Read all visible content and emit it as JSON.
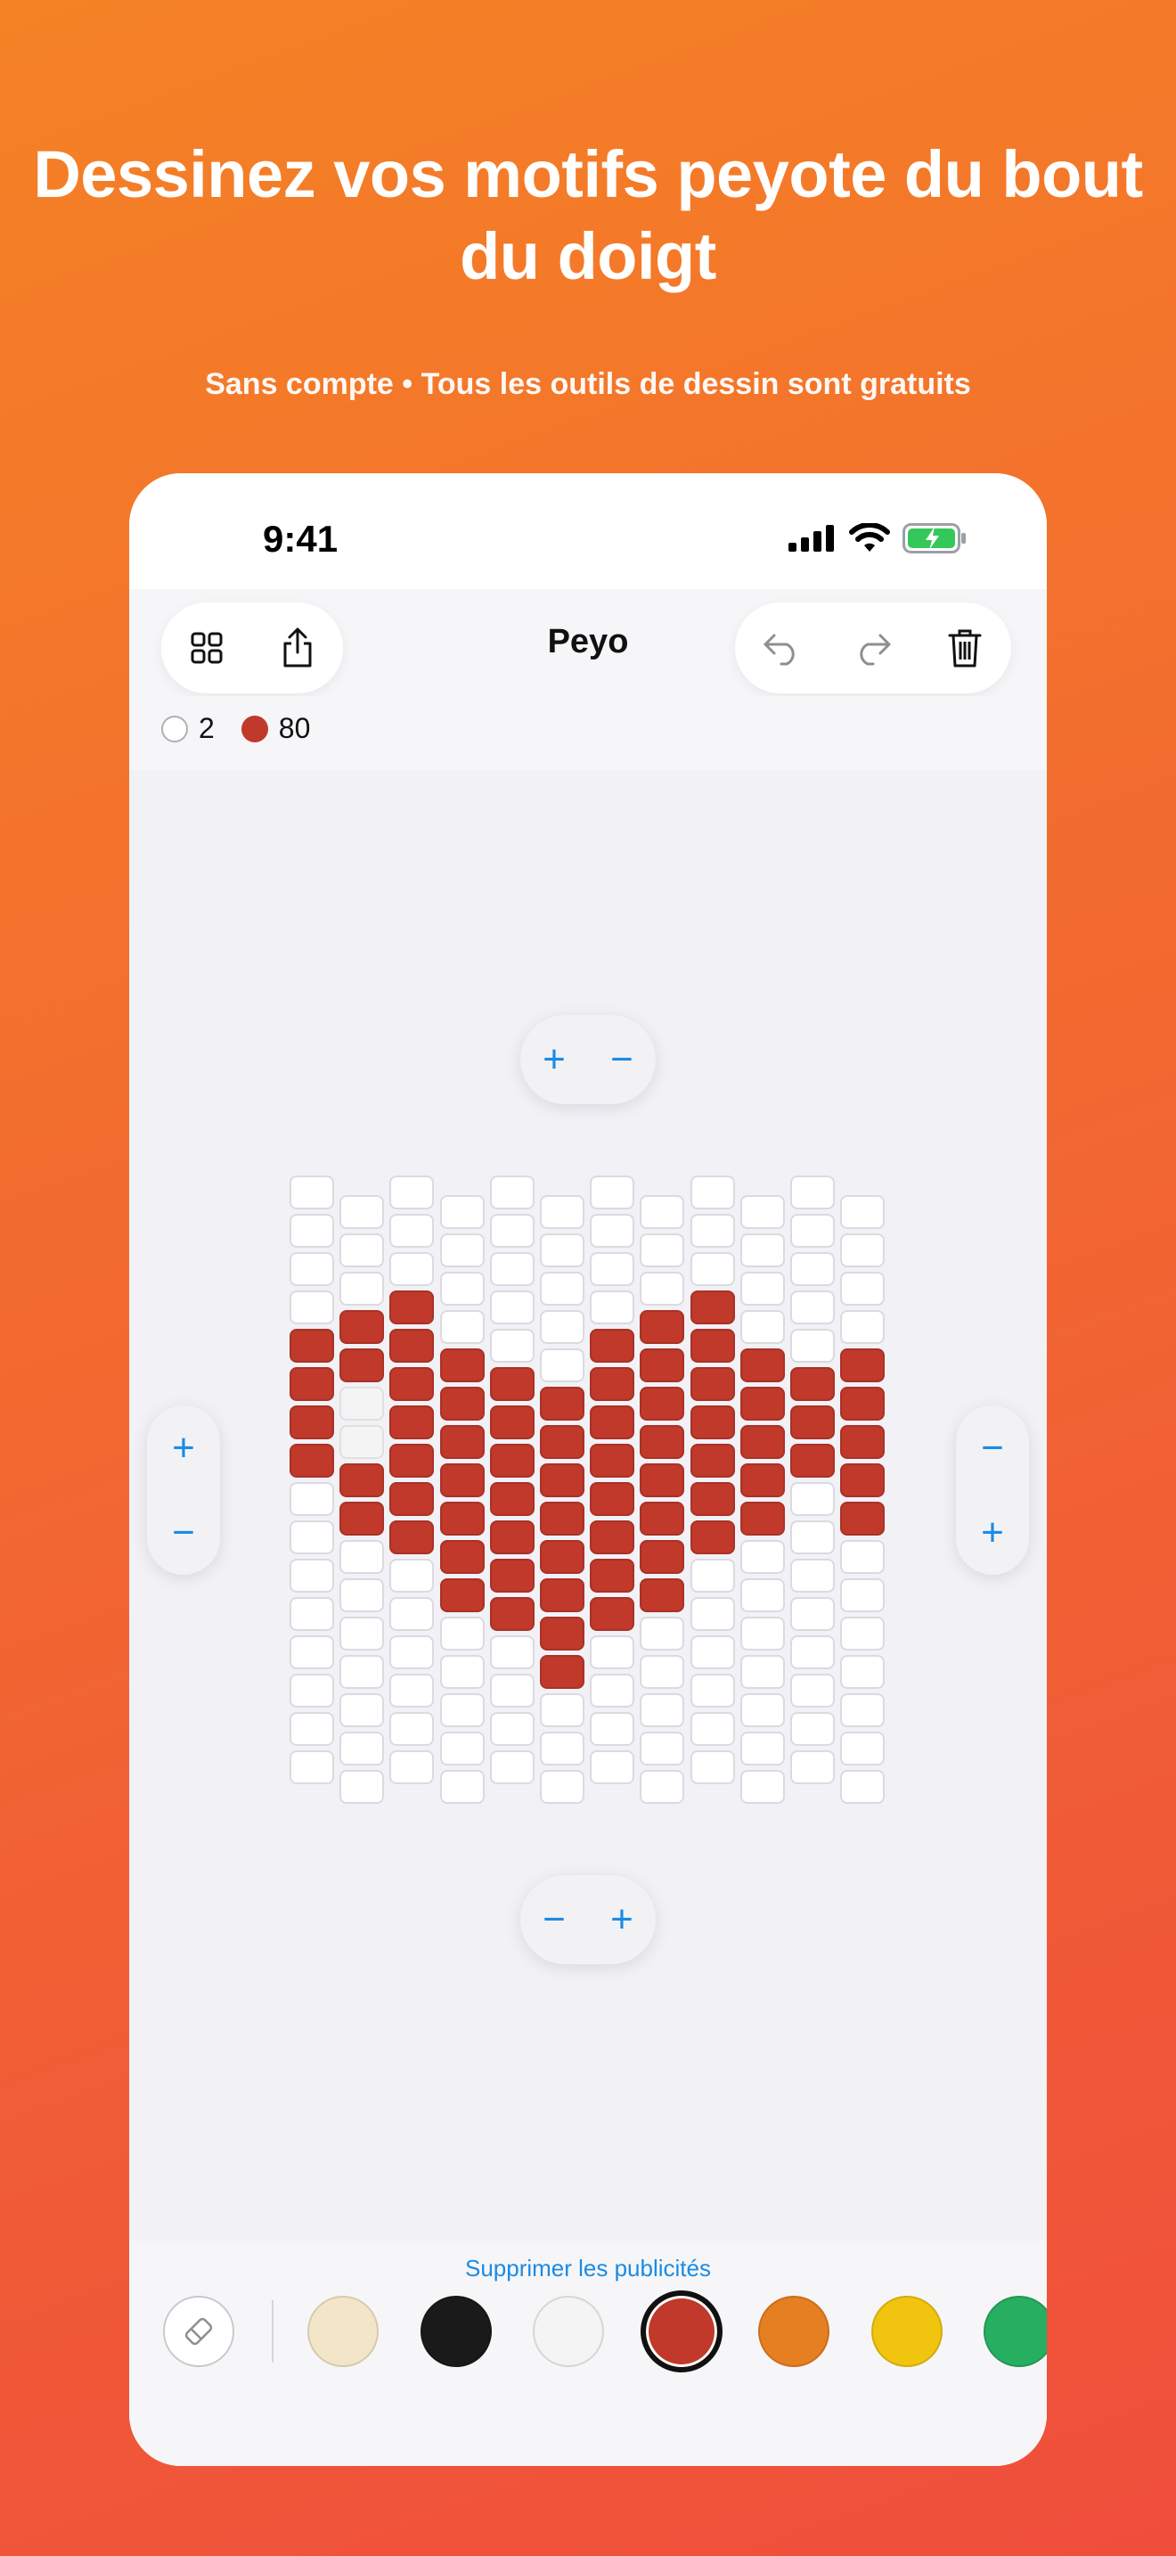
{
  "headline": "Dessinez vos motifs peyote du bout du doigt",
  "subheadline": "Sans compte • Tous les outils de dessin sont gratuits",
  "status_bar": {
    "time": "9:41"
  },
  "toolbar": {
    "title": "Peyo",
    "left_icons": [
      "grid-icon",
      "share-icon"
    ],
    "right_icons": [
      "undo-icon",
      "redo-icon",
      "trash-icon"
    ]
  },
  "color_counts": [
    {
      "color": "#FFFFFF",
      "count": "2"
    },
    {
      "color": "#C0392B",
      "count": "80"
    }
  ],
  "zoom_controls": {
    "top": [
      "+",
      "−"
    ],
    "bottom": [
      "−",
      "+"
    ],
    "left": [
      "+",
      "−"
    ],
    "right": [
      "−",
      "+"
    ]
  },
  "grid": {
    "rows": [
      "WWWWWWWWWWWW",
      "WWWWWWWWWWWW",
      "WWWWWWWWWWWW",
      "WRRWWWWRRWWW",
      "RRRRWWRRRRWR",
      "RLRRRRRRRRRR",
      "RLRRRRRRRRRR",
      "RRRRRRRRRRRR",
      "WRRRRRRRRRWR",
      "WWRRRRRRRWWW",
      "WWWRRRRRWWWW",
      "WWWWRRRWWWWW",
      "WWWWWRWWWWWW",
      "WWWWWWWWWWWW",
      "WWWWWWWWWWWW",
      "WWWWWWWWWWWW"
    ],
    "colors": {
      "W": "#FFFFFF",
      "R": "#C0392B",
      "L": "#F4F4F4"
    }
  },
  "remove_ads_label": "Supprimer les publicités",
  "palette": [
    {
      "color": "#F3E6C8",
      "selected": false
    },
    {
      "color": "#1A1A1A",
      "selected": false
    },
    {
      "color": "#F4F4F4",
      "selected": false
    },
    {
      "color": "#C0392B",
      "selected": true
    },
    {
      "color": "#E67E22",
      "selected": false
    },
    {
      "color": "#F1C40F",
      "selected": false
    },
    {
      "color": "#27AE60",
      "selected": false
    }
  ]
}
